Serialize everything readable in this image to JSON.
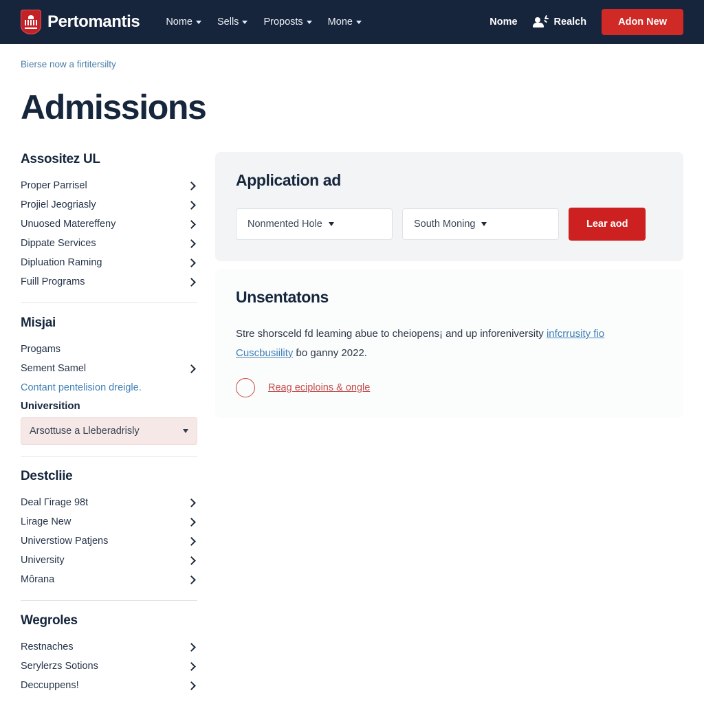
{
  "header": {
    "brand_name": "Pertomantis",
    "logo_icon": "shield-crest-icon",
    "nav": [
      {
        "label": "Nome"
      },
      {
        "label": "Sells"
      },
      {
        "label": "Proposts"
      },
      {
        "label": "Mone"
      }
    ],
    "home_link": "Nome",
    "account_icon": "person-sparkle-icon",
    "account_label": "Realch",
    "cta_label": "Adon New",
    "cta_color": "#cf2a25",
    "bar_color": "#16243c"
  },
  "breadcrumb": "Bierse now a firtitersilty",
  "page_title": "Admissions",
  "sidebar": {
    "groups": [
      {
        "heading": "Assositez UL",
        "items": [
          {
            "label": "Proper Parrisel",
            "chevron": true
          },
          {
            "label": "Projiel Jeogriasly",
            "chevron": true
          },
          {
            "label": "Unuosed Matereffeny",
            "chevron": true
          },
          {
            "label": "Dippate Services",
            "chevron": true
          },
          {
            "label": "Dipluation Raming",
            "chevron": true
          },
          {
            "label": "Fuill Programs",
            "chevron": true
          }
        ]
      },
      {
        "heading": "Misjai",
        "items": [
          {
            "label": "Progams",
            "chevron": false
          },
          {
            "label": "Sement Samel",
            "chevron": true
          }
        ],
        "link": "Contant pentelision dreigle.",
        "select_label": "Universition",
        "select_value": "Arsottuse a Lleberadrisly",
        "select_bg": "#f7e8e8"
      },
      {
        "heading": "Destcliie",
        "items": [
          {
            "label": "Deal Гirage 98t",
            "chevron": true
          },
          {
            "label": "Lirage New",
            "chevron": true
          },
          {
            "label": "Universtiow Patjens",
            "chevron": true
          },
          {
            "label": "University",
            "chevron": true
          },
          {
            "label": "Môrana",
            "chevron": true
          }
        ]
      },
      {
        "heading": "Wegroles",
        "items": [
          {
            "label": "Restnaches",
            "chevron": true
          },
          {
            "label": "Serylerzs Sotions",
            "chevron": true
          },
          {
            "label": "Deccuppens!",
            "chevron": true
          }
        ]
      }
    ]
  },
  "main": {
    "application_card": {
      "title": "Application ad",
      "filter_one": "Nonmented Hole",
      "filter_two": "South Moning",
      "button_label": "Lear aod",
      "button_color": "#cd2020",
      "bg": "#f2f4f5"
    },
    "info_card": {
      "title": "Unsentatons",
      "paragraph_before": "Stre shorsceld fԁ leaming abue to cheiopens¡ and up inforeniversity ",
      "paragraph_link": "infcrrusity fio Cuscbusiility",
      "paragraph_after": " ɓo ganny 2022.",
      "circle_icon": "circle-outline-icon",
      "read_link": "Reag eciploins & ongle",
      "link_color": "#c44b4b",
      "bg": "#fbfcfc"
    }
  }
}
